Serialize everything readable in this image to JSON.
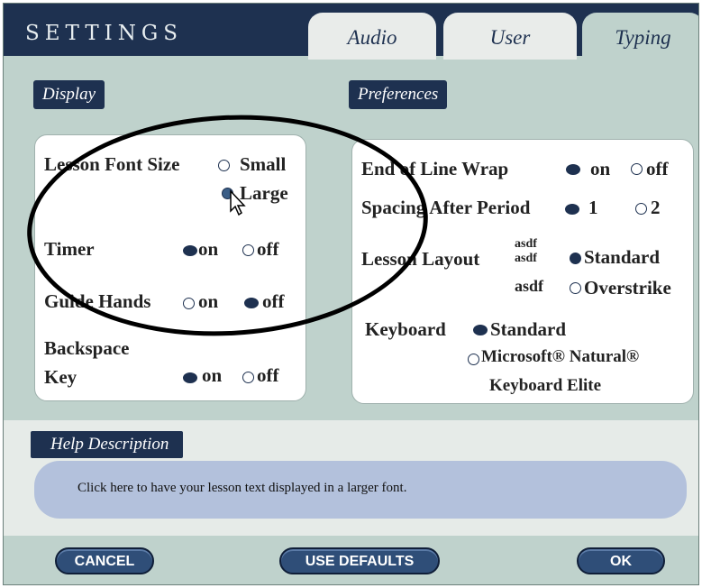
{
  "title": "SETTINGS",
  "tabs": [
    {
      "label": "Audio",
      "active": false
    },
    {
      "label": "User",
      "active": false
    },
    {
      "label": "Typing",
      "active": true
    }
  ],
  "display": {
    "heading": "Display",
    "lesson_font_size": {
      "label": "Lesson Font Size",
      "options": [
        "Small",
        "Large"
      ],
      "selected": "Large"
    },
    "timer": {
      "label": "Timer",
      "on": "on",
      "off": "off",
      "selected": "on"
    },
    "guide_hands": {
      "label": "Guide Hands",
      "on": "on",
      "off": "off",
      "selected": "off"
    },
    "backspace": {
      "label_line1": "Backspace",
      "label_line2": "Key",
      "on": "on",
      "off": "off",
      "selected": "on"
    }
  },
  "preferences": {
    "heading": "Preferences",
    "end_of_line_wrap": {
      "label": "End of Line Wrap",
      "on": "on",
      "off": "off",
      "selected": "on"
    },
    "spacing_after_period": {
      "label": "Spacing After Period",
      "opt1": "1",
      "opt2": "2",
      "selected": "1"
    },
    "lesson_layout": {
      "label": "Lesson Layout",
      "sample1": "asdf",
      "sample2": "asdf",
      "sample3": "asdf",
      "opt1": "Standard",
      "opt2": "Overstrike",
      "selected": "Standard"
    },
    "keyboard": {
      "label": "Keyboard",
      "opt1": "Standard",
      "opt2_line1": "Microsoft® Natural®",
      "opt2_line2": "Keyboard Elite",
      "selected": "Standard"
    }
  },
  "help": {
    "heading": "Help Description",
    "text": "Click here to have your lesson text displayed in a larger font."
  },
  "buttons": {
    "cancel": "CANCEL",
    "defaults": "USE DEFAULTS",
    "ok": "OK"
  },
  "colors": {
    "navy": "#1e3150",
    "background": "#bfd2cc",
    "help_box": "#b3c1dc",
    "button": "#2f4e78"
  }
}
